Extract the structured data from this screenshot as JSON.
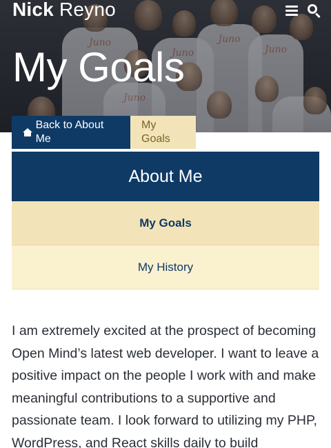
{
  "header": {
    "site_name_first": "Nick",
    "site_name_last": "Reyno",
    "menu_icon": "bars-icon",
    "search_icon": "search-icon"
  },
  "hero": {
    "title": "My Goals",
    "shirt_text": "Juno"
  },
  "tabs": {
    "back_label": "Back to About Me",
    "back_icon": "home-icon",
    "current_label": "My Goals"
  },
  "nav": {
    "header": "About Me",
    "items": [
      {
        "label": "My Goals",
        "active": true
      },
      {
        "label": "My History",
        "active": false
      }
    ]
  },
  "content": {
    "paragraph": "I am extremely excited at the prospect of becoming Open Mind’s latest web developer. I want to leave a positive impact on the people I work with and make meaningful contributions to a supportive and passionate team. I look forward to utilizing my PHP, WordPress, and React skills daily to build"
  },
  "colors": {
    "navy": "#0f3a66",
    "gold_active": "#f2e4b8",
    "gold_light": "#faf1cf",
    "tab_text_gold": "#7b6328"
  }
}
